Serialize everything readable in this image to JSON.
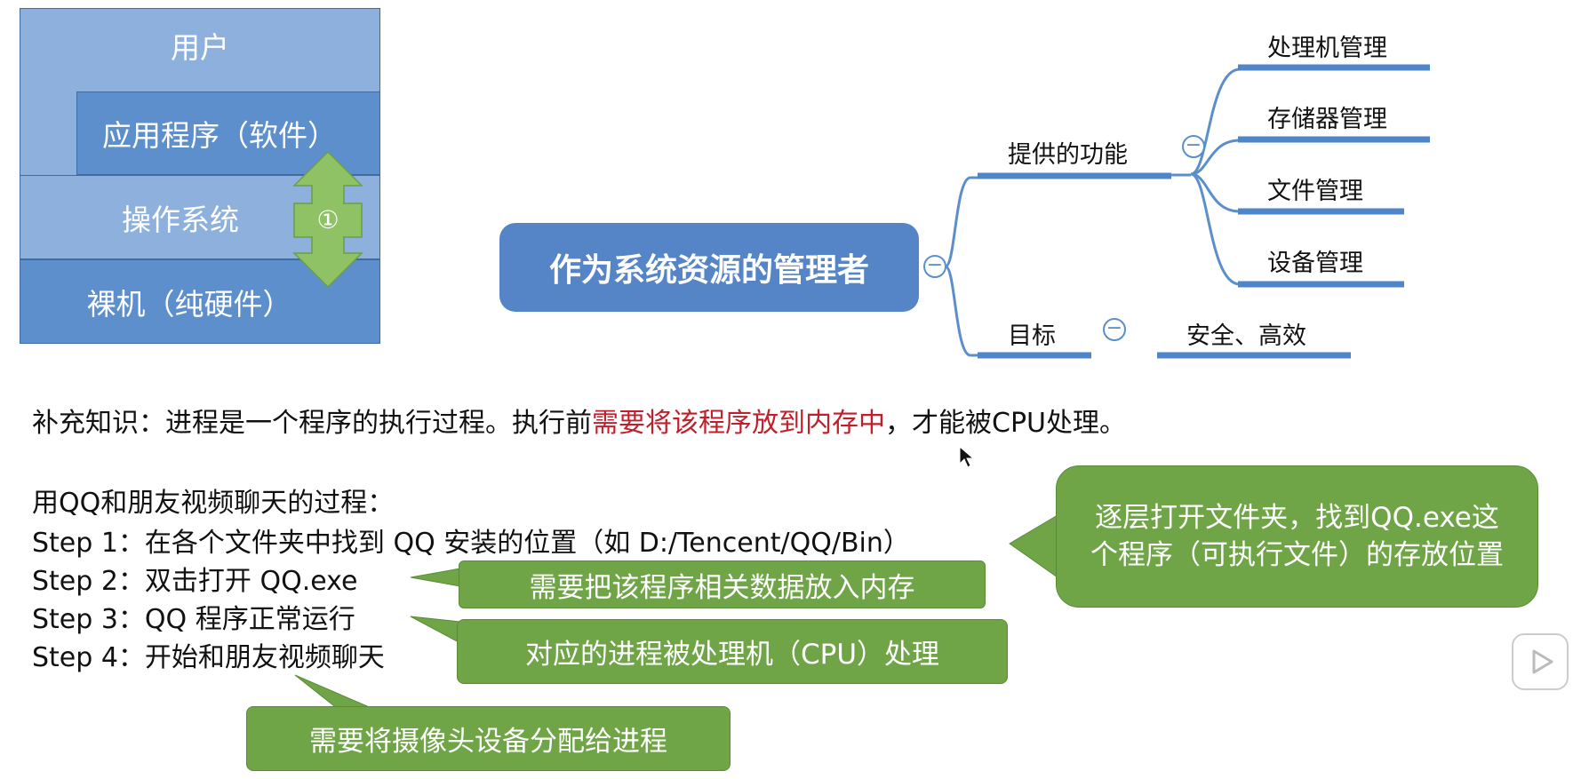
{
  "stack": {
    "user": "用户",
    "app": "应用程序（软件）",
    "os": "操作系统",
    "hardware": "裸机（纯硬件）",
    "badge": "①"
  },
  "mindmap": {
    "center": "作为系统资源的管理者",
    "functions": "提供的功能",
    "items": [
      "处理机管理",
      "存储器管理",
      "文件管理",
      "设备管理"
    ],
    "goal": "目标",
    "goal_value": "安全、高效"
  },
  "supplement": {
    "prefix": "补充知识：进程是一个程序的执行过程。执行前",
    "highlight": "需要将该程序放到内存中",
    "suffix": "，才能被CPU处理。"
  },
  "process": {
    "title": "用QQ和朋友视频聊天的过程：",
    "steps": [
      "Step 1：在各个文件夹中找到 QQ 安装的位置（如 D:/Tencent/QQ/Bin）",
      "Step 2：双击打开 QQ.exe",
      "Step 3：QQ 程序正常运行",
      "Step 4：开始和朋友视频聊天"
    ]
  },
  "callouts": {
    "find_exe": "逐层打开文件夹，找到QQ.exe这个程序（可执行文件）的存放位置",
    "load_memory": "需要把该程序相关数据放入内存",
    "cpu": "对应的进程被处理机（CPU）处理",
    "camera": "需要将摄像头设备分配给进程"
  },
  "colors": {
    "layer_light": "#8db1dc",
    "layer_dark": "#5c8fcb",
    "node": "#5585c6",
    "callout": "#70a547",
    "highlight": "#c0202b"
  }
}
